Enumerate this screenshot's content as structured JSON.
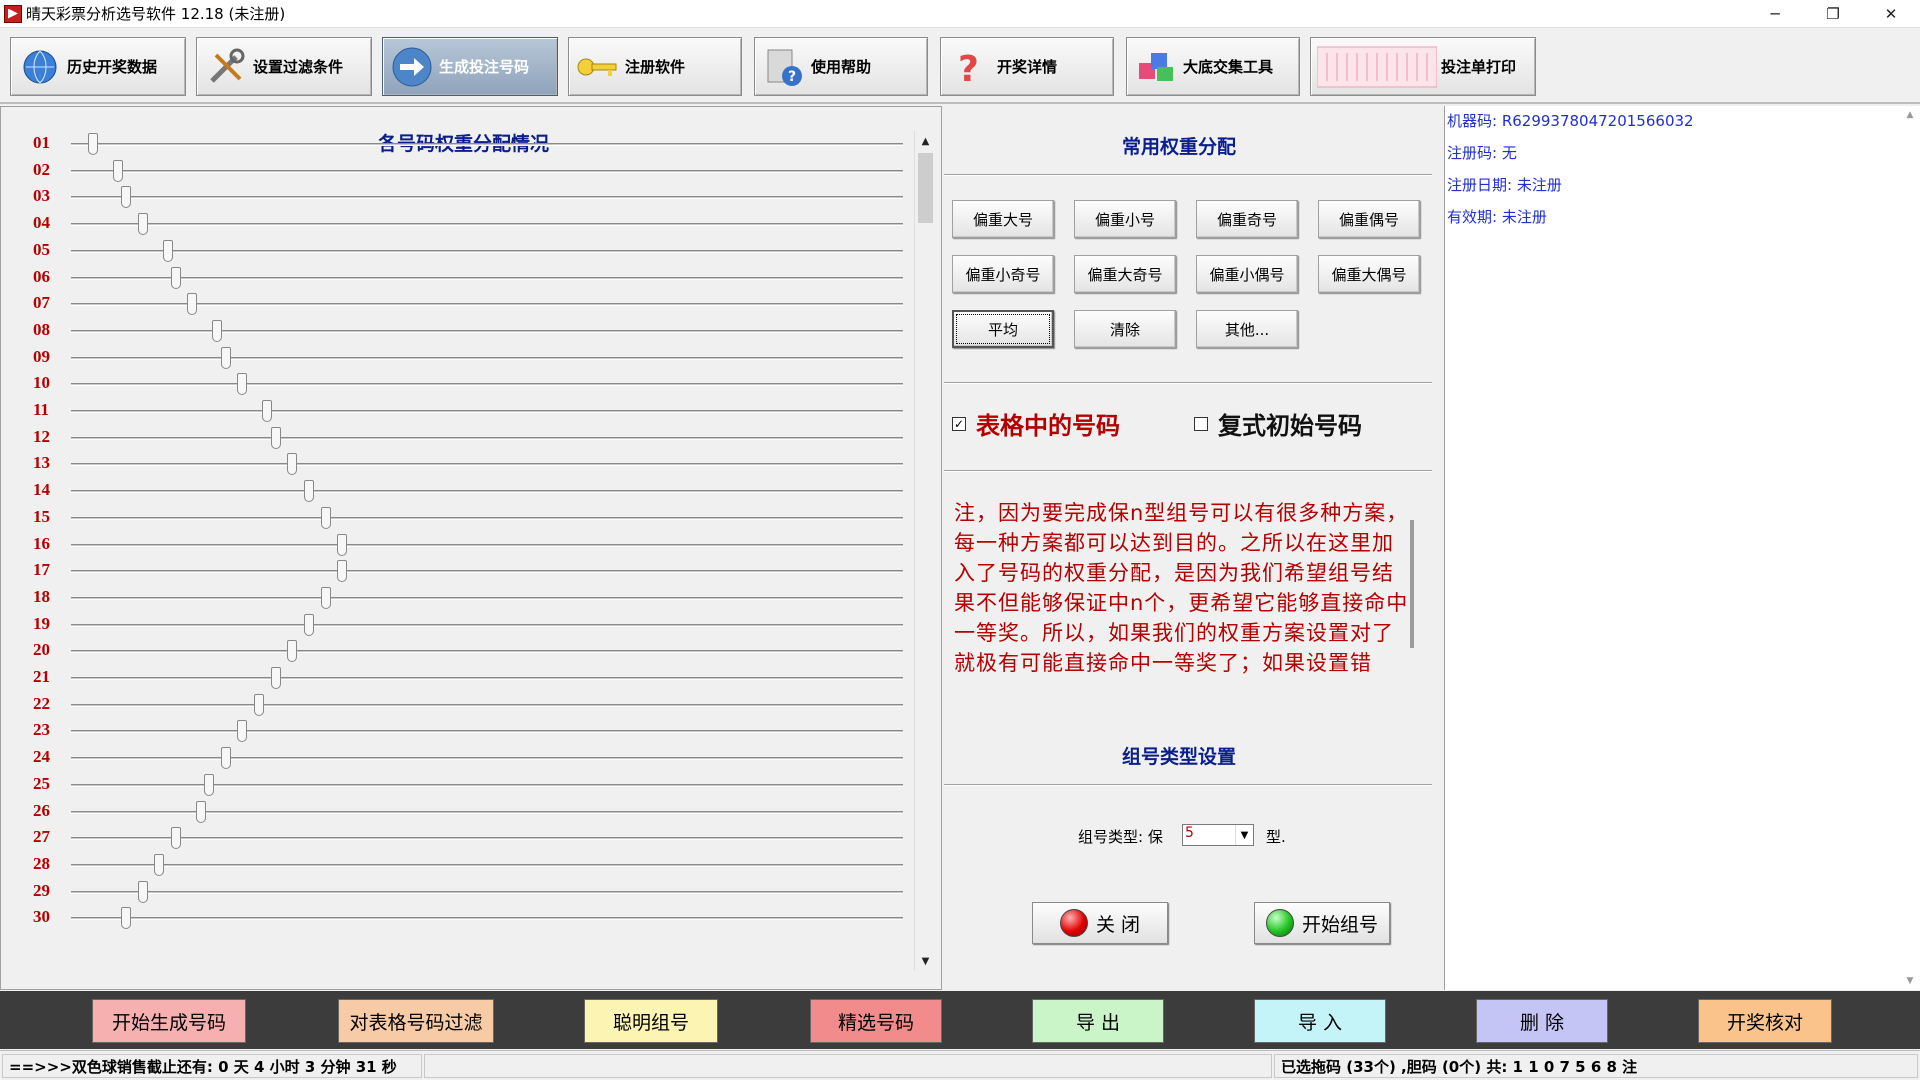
{
  "window": {
    "title": "晴天彩票分析选号软件 12.18 (未注册)",
    "controls": [
      "─",
      "❐",
      "✕"
    ]
  },
  "toolbar": {
    "buttons": [
      {
        "label": "历史开奖数据",
        "icon": "globe-icon"
      },
      {
        "label": "设置过滤条件",
        "icon": "tools-icon"
      },
      {
        "label": "生成投注号码",
        "icon": "arrow-icon",
        "active": true
      },
      {
        "label": "注册软件",
        "icon": "key-icon"
      },
      {
        "label": "使用帮助",
        "icon": "help-book-icon"
      },
      {
        "label": "开奖详情",
        "icon": "question-icon"
      },
      {
        "label": "大底交集工具",
        "icon": "cubes-icon"
      },
      {
        "label": "投注单打印",
        "icon": "ticket-icon"
      }
    ]
  },
  "weights": {
    "title": "各号码权重分配情况",
    "rows": [
      {
        "num": "01",
        "level": 0.02
      },
      {
        "num": "02",
        "level": 0.05
      },
      {
        "num": "03",
        "level": 0.06
      },
      {
        "num": "04",
        "level": 0.08
      },
      {
        "num": "05",
        "level": 0.11
      },
      {
        "num": "06",
        "level": 0.12
      },
      {
        "num": "07",
        "level": 0.14
      },
      {
        "num": "08",
        "level": 0.17
      },
      {
        "num": "09",
        "level": 0.18
      },
      {
        "num": "10",
        "level": 0.2
      },
      {
        "num": "11",
        "level": 0.23
      },
      {
        "num": "12",
        "level": 0.24
      },
      {
        "num": "13",
        "level": 0.26
      },
      {
        "num": "14",
        "level": 0.28
      },
      {
        "num": "15",
        "level": 0.3
      },
      {
        "num": "16",
        "level": 0.32
      },
      {
        "num": "17",
        "level": 0.32
      },
      {
        "num": "18",
        "level": 0.3
      },
      {
        "num": "19",
        "level": 0.28
      },
      {
        "num": "20",
        "level": 0.26
      },
      {
        "num": "21",
        "level": 0.24
      },
      {
        "num": "22",
        "level": 0.22
      },
      {
        "num": "23",
        "level": 0.2
      },
      {
        "num": "24",
        "level": 0.18
      },
      {
        "num": "25",
        "level": 0.16
      },
      {
        "num": "26",
        "level": 0.15
      },
      {
        "num": "27",
        "level": 0.12
      },
      {
        "num": "28",
        "level": 0.1
      },
      {
        "num": "29",
        "level": 0.08
      },
      {
        "num": "30",
        "level": 0.06
      }
    ]
  },
  "common": {
    "title": "常用权重分配",
    "buttons": [
      [
        "偏重大号",
        "偏重小号",
        "偏重奇号",
        "偏重偶号"
      ],
      [
        "偏重小奇号",
        "偏重大奇号",
        "偏重小偶号",
        "偏重大偶号"
      ],
      [
        "平均",
        "清除",
        "其他..."
      ]
    ]
  },
  "options": {
    "table_numbers": {
      "label": "表格中的号码",
      "checked": true,
      "mark": "✓"
    },
    "compound_start": {
      "label": "复式初始号码",
      "checked": false,
      "mark": ""
    }
  },
  "note": "注，因为要完成保n型组号可以有很多种方案，每一种方案都可以达到目的。之所以在这里加入了号码的权重分配，是因为我们希望组号结果不但能够保证中n个，更希望它能够直接命中一等奖。所以，如果我们的权重方案设置对了就极有可能直接命中一等奖了；如果设置错",
  "group": {
    "title": "组号类型设置",
    "label_prefix": "组号类型: 保",
    "value": "5",
    "label_suffix": "型.",
    "close_label": "关 闭",
    "start_label": "开始组号",
    "close_color": "#e00000",
    "start_color": "#22c422"
  },
  "info": {
    "machine": "机器码: R6299378047201566032",
    "reg_code": "注册码: 无",
    "reg_date": "注册日期: 未注册",
    "valid": "有效期: 未注册"
  },
  "bottom": {
    "buttons": [
      {
        "label": "开始生成号码",
        "color": "#f7b0b0"
      },
      {
        "label": "对表格号码过滤",
        "color": "#f7cba5"
      },
      {
        "label": "聪明组号",
        "color": "#fbf4b3"
      },
      {
        "label": "精选号码",
        "color": "#f28b8b"
      },
      {
        "label": "导 出",
        "color": "#c9f5c9"
      },
      {
        "label": "导 入",
        "color": "#c4f3f8"
      },
      {
        "label": "删 除",
        "color": "#c5c5f5"
      },
      {
        "label": "开奖核对",
        "color": "#f9c38b"
      }
    ]
  },
  "status": {
    "countdown": "==>>>双色球销售截止还有: 0 天 4 小时 3 分钟 31 秒",
    "middle": "",
    "selection": "已选拖码 (33个) ,胆码 (0个) 共: 1 1 0 7 5 6 8 注"
  }
}
